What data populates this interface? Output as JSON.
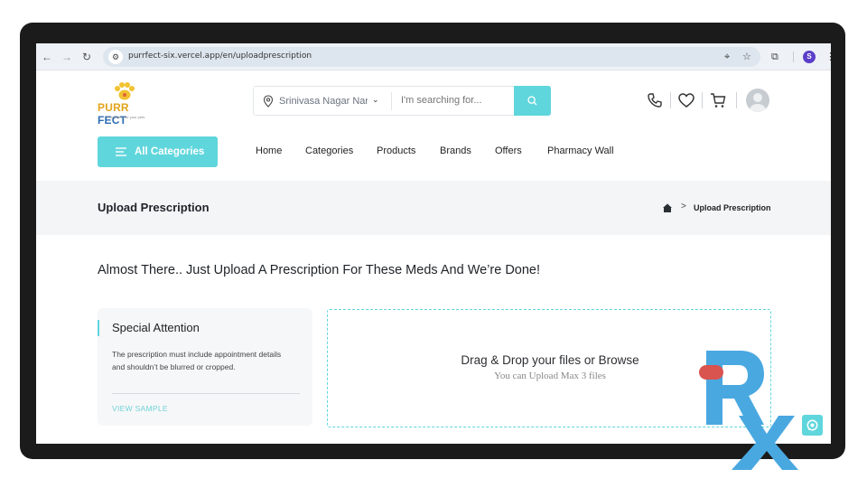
{
  "browser": {
    "url": "purrfect-six.vercel.app/en/uploadprescription",
    "profile_initial": "S"
  },
  "logo": {
    "word_a": "PURR",
    "word_b": "FECT",
    "tagline": "Everything for your pets"
  },
  "search": {
    "location": "Srinivasa Nagar Nand",
    "placeholder": "I'm searching for..."
  },
  "categories_button": "All Categories",
  "nav": [
    "Home",
    "Categories",
    "Products",
    "Brands",
    "Offers",
    "Pharmacy Wall"
  ],
  "breadcrumb": {
    "page_title": "Upload Prescription",
    "separator": ">",
    "current": "Upload Prescription"
  },
  "headline": "Almost There.. Just Upload A Prescription For These Meds And We’re Done!",
  "attention": {
    "title": "Special Attention",
    "body": "The prescription must include appointment details and shouldn’t be blurred or cropped.",
    "link": "VIEW SAMPLE"
  },
  "dropzone": {
    "title": "Drag & Drop your files or Browse",
    "subtitle": "You can Upload Max 3 files"
  },
  "colors": {
    "accent": "#5fd6dc",
    "logo_yellow": "#e2a51c",
    "logo_blue": "#2c6db5",
    "rx_blue": "#4aa8e0",
    "rx_red": "#d9534f"
  }
}
